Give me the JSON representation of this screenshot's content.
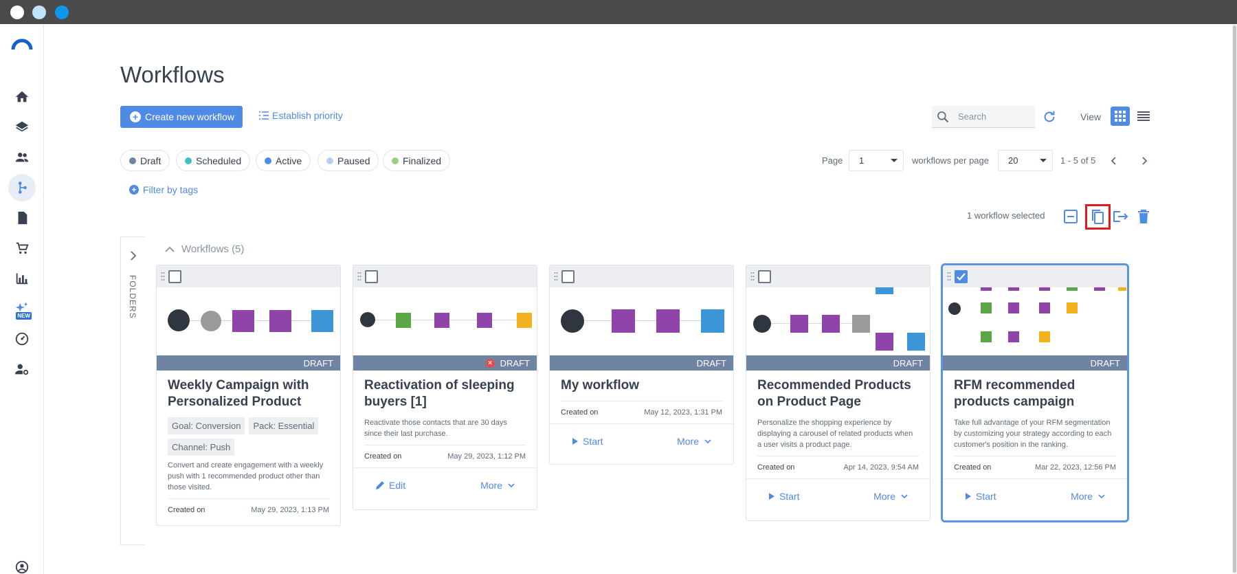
{
  "window": {
    "controls": [
      "close",
      "minimize",
      "maximize"
    ]
  },
  "sidebar": {
    "items": [
      {
        "icon": "home-icon"
      },
      {
        "icon": "layers-icon"
      },
      {
        "icon": "contacts-icon"
      },
      {
        "icon": "workflow-icon",
        "active": true
      },
      {
        "icon": "document-icon"
      },
      {
        "icon": "cart-icon"
      },
      {
        "icon": "bar-chart-icon"
      },
      {
        "icon": "sparkles-icon",
        "badge": "NEW"
      },
      {
        "icon": "dashboard-icon"
      },
      {
        "icon": "user-settings-icon"
      }
    ],
    "account_icon": "account-icon"
  },
  "header": {
    "title": "Workflows",
    "create_label": "Create new workflow",
    "priority_label": "Establish priority",
    "search_placeholder": "Search",
    "view_label": "View"
  },
  "filters": {
    "chips": [
      {
        "label": "Draft",
        "color": "#6f83a3"
      },
      {
        "label": "Scheduled",
        "color": "#3cbfc9"
      },
      {
        "label": "Active",
        "color": "#4f8ae5"
      },
      {
        "label": "Paused",
        "color": "#b8cff2"
      },
      {
        "label": "Finalized",
        "color": "#9ccf7f"
      }
    ],
    "tags_label": "Filter by tags"
  },
  "pagination": {
    "page_label": "Page",
    "page_value": "1",
    "per_page_label": "workflows per page",
    "per_page_value": "20",
    "range": "1 - 5 of 5"
  },
  "selection": {
    "text": "1 workflow selected"
  },
  "folders_label": "FOLDERS",
  "group_title": "Workflows (5)",
  "cards": [
    {
      "title": "Weekly Campaign with Personalized Product",
      "status": "DRAFT",
      "tags": [
        "Goal: Conversion",
        "Pack: Essential",
        "Channel: Push"
      ],
      "description": "Convert and create engagement with a weekly push with 1 recommended product other than those visited.",
      "created_label": "Created on",
      "created_value": "May 29, 2023, 1:13 PM",
      "checked": false
    },
    {
      "title": "Reactivation of sleeping buyers [1]",
      "status": "DRAFT",
      "error": true,
      "description": "Reactivate those contacts that are 30 days since their last purchase.",
      "created_label": "Created on",
      "created_value": "May 29, 2023, 1:12 PM",
      "primary_action": "Edit",
      "more_label": "More",
      "checked": false
    },
    {
      "title": "My workflow",
      "status": "DRAFT",
      "created_label": "Created on",
      "created_value": "May 12, 2023, 1:31 PM",
      "primary_action": "Start",
      "more_label": "More",
      "checked": false
    },
    {
      "title": "Recommended Products on Product Page",
      "status": "DRAFT",
      "description": "Personalize the shopping experience by displaying a carousel of related products when a user visits a product page.",
      "created_label": "Created on",
      "created_value": "Apr 14, 2023, 9:54 AM",
      "primary_action": "Start",
      "more_label": "More",
      "checked": false
    },
    {
      "title": "RFM recommended products campaign",
      "status": "DRAFT",
      "description": "Take full advantage of your RFM segmentation by customizing your strategy according to each customer's position in the ranking.",
      "created_label": "Created on",
      "created_value": "Mar 22, 2023, 12:56 PM",
      "primary_action": "Start",
      "more_label": "More",
      "checked": true
    }
  ],
  "colors": {
    "accent": "#4f8ae5",
    "draft_bar": "#6f83a3",
    "node_purple": "#8e44a8",
    "node_green": "#5aa845",
    "node_blue": "#3b95d6",
    "node_yellow": "#f2b220",
    "node_dark": "#2f3640",
    "node_gray": "#9a9a9a",
    "highlight": "#e01b1b"
  }
}
